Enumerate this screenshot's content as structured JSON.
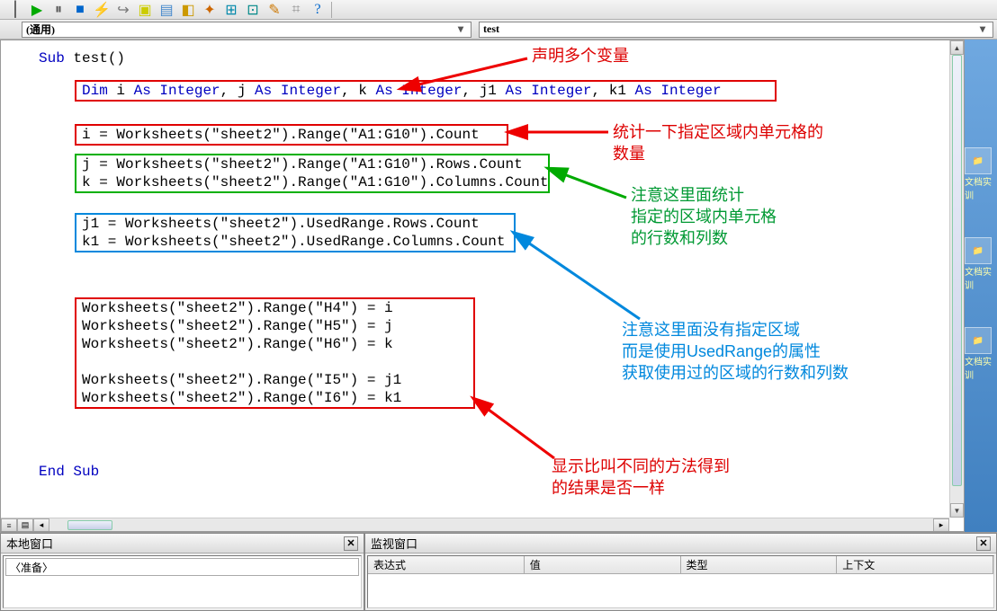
{
  "toolbar": {
    "icons": [
      "separator",
      "play",
      "pause",
      "stop",
      "debug",
      "project",
      "copy",
      "ref1",
      "ref2",
      "bookmark",
      "win1",
      "win2",
      "toolbox",
      "ocx",
      "help"
    ]
  },
  "dropdowns": {
    "object": "(通用)",
    "procedure": "test"
  },
  "code": {
    "sub_start": "Sub test()",
    "dim_line": "Dim i As Integer, j As Integer, k As Integer, j1 As Integer, k1 As Integer",
    "line_i": "i = Worksheets(\"sheet2\").Range(\"A1:G10\").Count",
    "line_j": "j = Worksheets(\"sheet2\").Range(\"A1:G10\").Rows.Count",
    "line_k": "k = Worksheets(\"sheet2\").Range(\"A1:G10\").Columns.Count",
    "line_j1": "j1 = Worksheets(\"sheet2\").UsedRange.Rows.Count",
    "line_k1": "k1 = Worksheets(\"sheet2\").UsedRange.Columns.Count",
    "line_h4": "Worksheets(\"sheet2\").Range(\"H4\") = i",
    "line_h5": "Worksheets(\"sheet2\").Range(\"H5\") = j",
    "line_h6": "Worksheets(\"sheet2\").Range(\"H6\") = k",
    "line_i5": "Worksheets(\"sheet2\").Range(\"I5\") = j1",
    "line_i6": "Worksheets(\"sheet2\").Range(\"I6\") = k1",
    "sub_end": "End Sub"
  },
  "annotations": {
    "a1": "声明多个变量",
    "a2_l1": "统计一下指定区域内单元格的",
    "a2_l2": "数量",
    "a3_l1": "注意这里面统计",
    "a3_l2": "指定的区域内单元格",
    "a3_l3": "的行数和列数",
    "a4_l1": "注意这里面没有指定区域",
    "a4_l2": "而是使用UsedRange的属性",
    "a4_l3": "获取使用过的区域的行数和列数",
    "a5_l1": "显示比叫不同的方法得到",
    "a5_l2": "的结果是否一样"
  },
  "panels": {
    "immediate_title": "本地窗口",
    "immediate_field": "〈准备〉",
    "watch_title": "监视窗口",
    "watch_cols": {
      "c1": "表达式",
      "c2": "值",
      "c3": "类型",
      "c4": "上下文"
    }
  },
  "sidebar": {
    "items": [
      "文档实训",
      "文档实训",
      "文档实训"
    ]
  }
}
